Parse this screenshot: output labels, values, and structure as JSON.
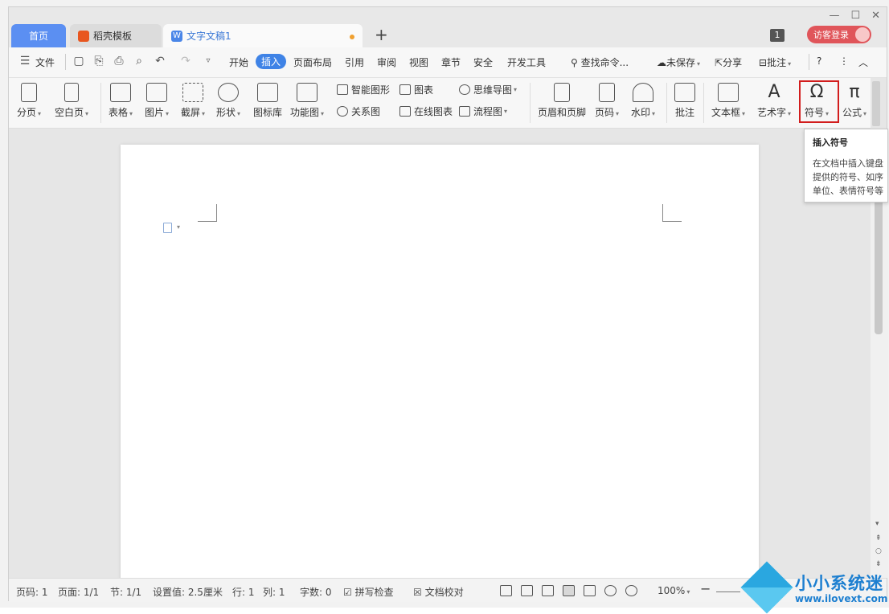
{
  "tabs": {
    "home": "首页",
    "template": "稻壳模板",
    "document": "文字文稿1",
    "new_tab": "+"
  },
  "window": {
    "minimize": "—",
    "maximize": "☐",
    "close": "✕",
    "counter": "1",
    "guest_login": "访客登录"
  },
  "menu": {
    "file": "文件",
    "items": [
      "开始",
      "插入",
      "页面布局",
      "引用",
      "审阅",
      "视图",
      "章节",
      "安全",
      "开发工具"
    ],
    "active": "插入",
    "search": "查找命令...",
    "unsaved": "未保存",
    "share": "分享",
    "comment": "批注",
    "help": "?",
    "more": "⋮"
  },
  "ribbon": {
    "page_break": "分页",
    "blank_page": "空白页",
    "table": "表格",
    "picture": "图片",
    "screenshot": "截屏",
    "shape": "形状",
    "icon_lib": "图标库",
    "function_chart": "功能图",
    "smart_shape": "智能图形",
    "chart": "图表",
    "mind_map": "思维导图",
    "relation_chart": "关系图",
    "online_chart": "在线图表",
    "flowchart": "流程图",
    "header_footer": "页眉和页脚",
    "page_number": "页码",
    "watermark": "水印",
    "annotation": "批注",
    "text_box": "文本框",
    "word_art": "艺术字",
    "symbol": "符号",
    "formula": "公式"
  },
  "tooltip": {
    "title": "插入符号",
    "lines": [
      "在文档中插入键盘",
      "提供的符号、如序",
      "单位、表情符号等"
    ]
  },
  "status": {
    "page_num": "页码: 1",
    "pages": "页面: 1/1",
    "section": "节: 1/1",
    "setting": "设置值: 2.5厘米",
    "row": "行: 1",
    "col": "列: 1",
    "word_count": "字数: 0",
    "spell_check": "拼写检查",
    "doc_proof": "文档校对",
    "zoom": "100%"
  },
  "watermark_site": {
    "name": "小小系统迷",
    "url": "www.ilovext.com"
  }
}
